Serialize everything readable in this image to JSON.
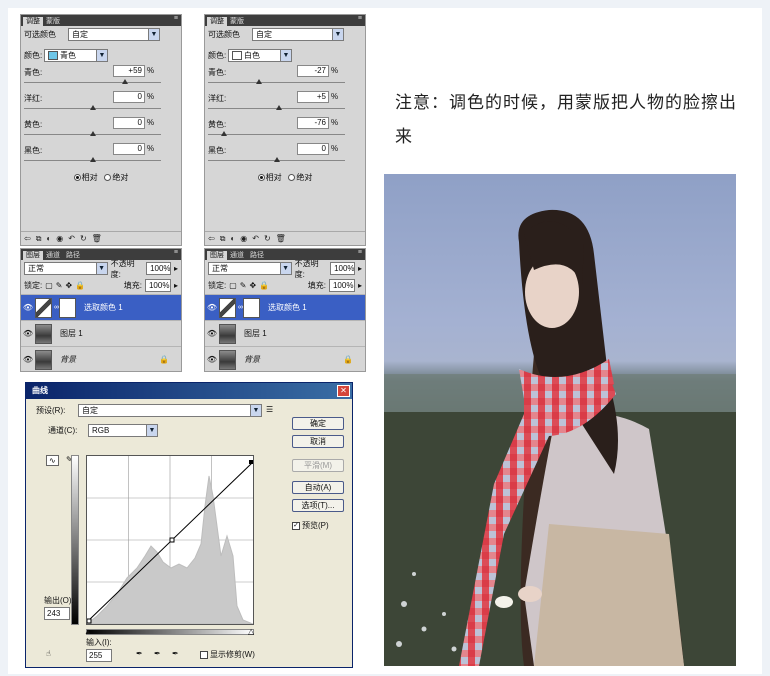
{
  "panel_tabs": [
    "调整",
    "蒙版"
  ],
  "layer_tabs": [
    "图层",
    "通道",
    "路径"
  ],
  "menu_glyph": "≡",
  "left_panel": {
    "preset_label": "可选颜色",
    "preset_value": "自定",
    "color_label": "颜色:",
    "color_value": "青色",
    "swatch_color": "#6ec6e8",
    "sliders": [
      {
        "label": "青色:",
        "value": "+59",
        "thumb_frac": 0.74
      },
      {
        "label": "洋红:",
        "value": "0",
        "thumb_frac": 0.5
      },
      {
        "label": "黄色:",
        "value": "0",
        "thumb_frac": 0.5
      },
      {
        "label": "黑色:",
        "value": "0",
        "thumb_frac": 0.5
      }
    ],
    "unit": "%",
    "radio_relative": "相对",
    "radio_absolute": "绝对"
  },
  "right_panel": {
    "preset_label": "可选颜色",
    "preset_value": "自定",
    "color_label": "颜色:",
    "color_value": "白色",
    "swatch_color": "#ffffff",
    "sliders": [
      {
        "label": "青色:",
        "value": "-27",
        "thumb_frac": 0.37
      },
      {
        "label": "洋红:",
        "value": "+5",
        "thumb_frac": 0.52
      },
      {
        "label": "黄色:",
        "value": "-76",
        "thumb_frac": 0.12
      },
      {
        "label": "黑色:",
        "value": "0",
        "thumb_frac": 0.5
      }
    ],
    "unit": "%",
    "radio_relative": "相对",
    "radio_absolute": "绝对"
  },
  "layers_panel": {
    "blend_mode": "正常",
    "opacity_label": "不透明度:",
    "opacity_value": "100%",
    "lock_label": "锁定:",
    "fill_label": "填充:",
    "fill_value": "100%",
    "layers": [
      "选取颜色 1",
      "图层 1",
      "背景"
    ]
  },
  "curves": {
    "title": "曲线",
    "preset_label": "预设(R):",
    "preset_value": "自定",
    "channel_label": "通道(C):",
    "channel_value": "RGB",
    "buttons": [
      "确定",
      "取消",
      "平滑(M)",
      "自动(A)",
      "选项(T)..."
    ],
    "preview_label": "预览(P)",
    "output_label": "输出(O):",
    "output_value": "243",
    "input_label": "输入(I):",
    "input_value": "255",
    "show_clipping": "显示修剪(W)"
  },
  "note": "注意：调色的时候，用蒙版把人物的脸擦出来"
}
